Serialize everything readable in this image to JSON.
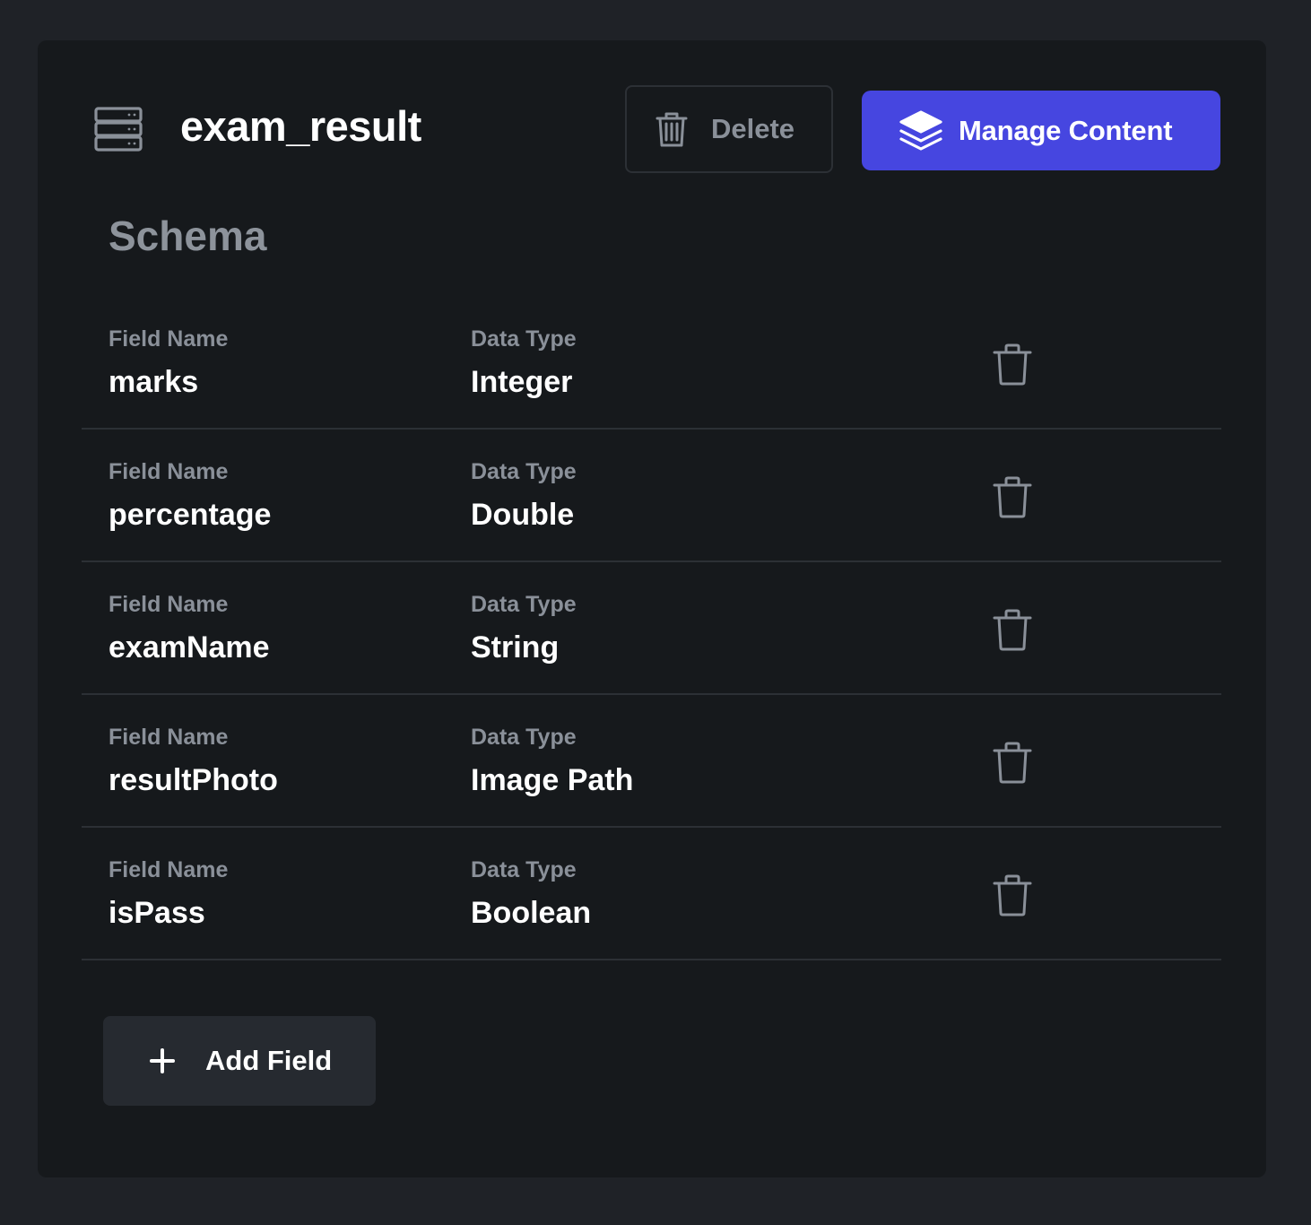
{
  "collection": {
    "title": "exam_result",
    "icon": "server-stack-icon"
  },
  "toolbar": {
    "delete_label": "Delete",
    "delete_icon": "trash-icon",
    "manage_label": "Manage Content",
    "manage_icon": "layers-icon",
    "accent_color": "#4646e0"
  },
  "schema": {
    "heading": "Schema",
    "field_label": "Field Name",
    "type_label": "Data Type",
    "fields": [
      {
        "name": "marks",
        "type": "Integer"
      },
      {
        "name": "percentage",
        "type": "Double"
      },
      {
        "name": "examName",
        "type": "String"
      },
      {
        "name": "resultPhoto",
        "type": "Image Path"
      },
      {
        "name": "isPass",
        "type": "Boolean"
      }
    ]
  },
  "add_field": {
    "label": "Add Field",
    "icon": "plus-icon"
  }
}
